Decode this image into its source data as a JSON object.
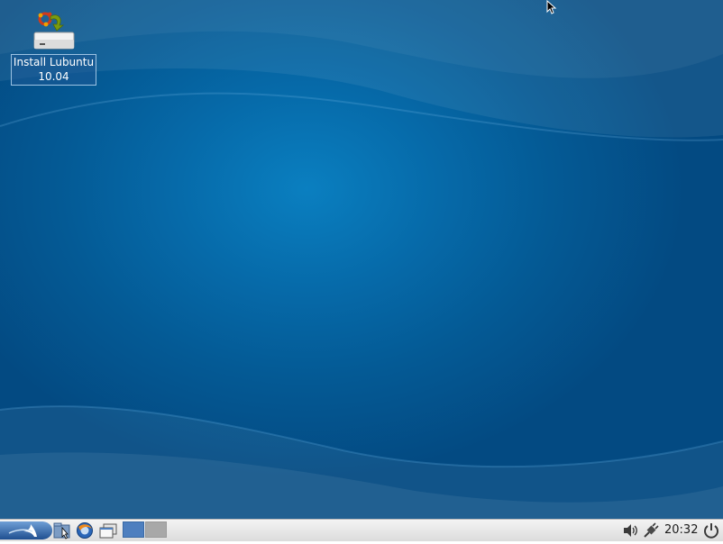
{
  "desktop": {
    "icons": [
      {
        "label_line1": "Install Lubuntu",
        "label_line2": "10.04",
        "icon": "installer-drive-icon"
      }
    ]
  },
  "taskbar": {
    "menu_icon": "lubuntu-menu-icon",
    "launchers": [
      {
        "icon": "file-manager-icon"
      },
      {
        "icon": "web-browser-icon"
      },
      {
        "icon": "show-desktop-icon"
      }
    ],
    "workspaces": [
      {
        "active": true
      },
      {
        "active": false
      }
    ],
    "tray": {
      "volume_icon": "speaker-icon",
      "network_icon": "network-plug-icon",
      "clock": "20:32",
      "power_icon": "power-icon"
    }
  },
  "colors": {
    "wallpaper_center": "#0a7fc0",
    "wallpaper_edge": "#034a82",
    "taskbar_bg": "#e8e8e8",
    "active_workspace": "#4e7fbf",
    "inactive_workspace": "#a8a8a8"
  }
}
